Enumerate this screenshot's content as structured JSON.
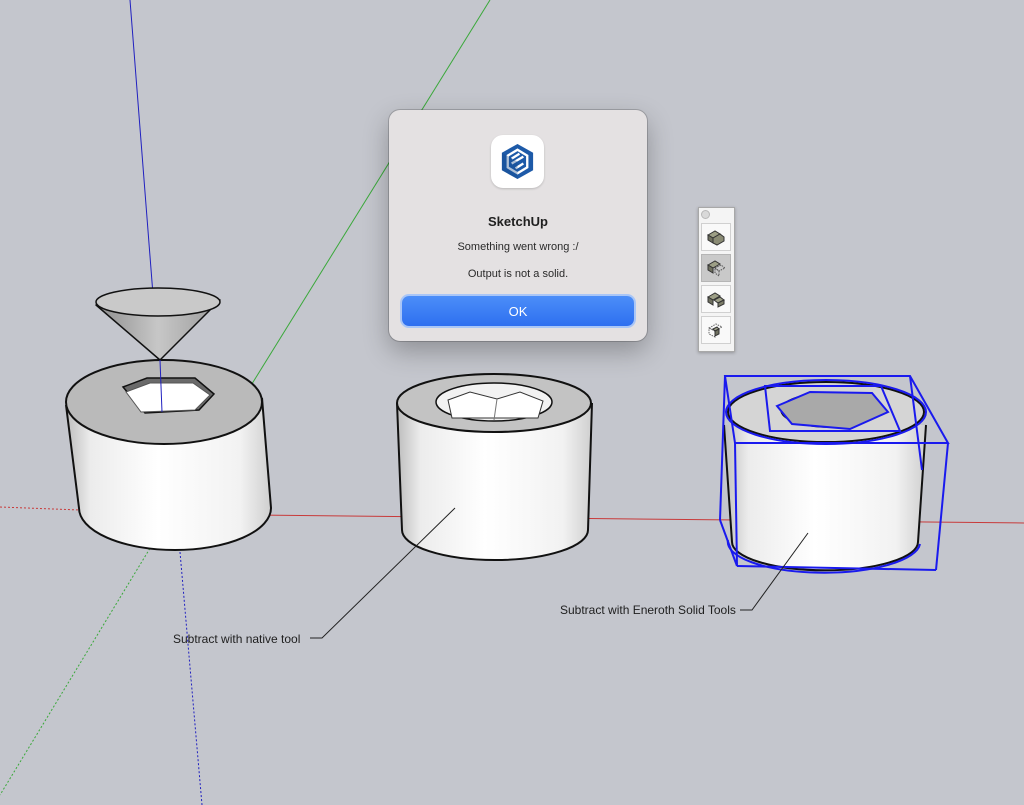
{
  "dialog": {
    "title": "SketchUp",
    "message": "Something went wrong :/",
    "detail": "Output is not a solid.",
    "ok_label": "OK",
    "icon": "sketchup-logo-icon"
  },
  "viewport": {
    "annotations": {
      "native": "Subtract with native tool",
      "eneroth": "Subtract with Eneroth Solid Tools"
    }
  },
  "toolbar": {
    "tools": [
      {
        "icon": "union-tool-icon",
        "active": false
      },
      {
        "icon": "subtract-tool-icon",
        "active": true
      },
      {
        "icon": "trim-tool-icon",
        "active": false
      },
      {
        "icon": "intersect-tool-icon",
        "active": false
      }
    ]
  },
  "colors": {
    "background": "#c4c6cd",
    "red_axis": "#c83a3a",
    "green_axis": "#3aa83a",
    "blue_axis": "#2020c0",
    "selection": "#1a1aee",
    "ok_button": "#3a7cf5",
    "brand": "#1d5aa8"
  }
}
